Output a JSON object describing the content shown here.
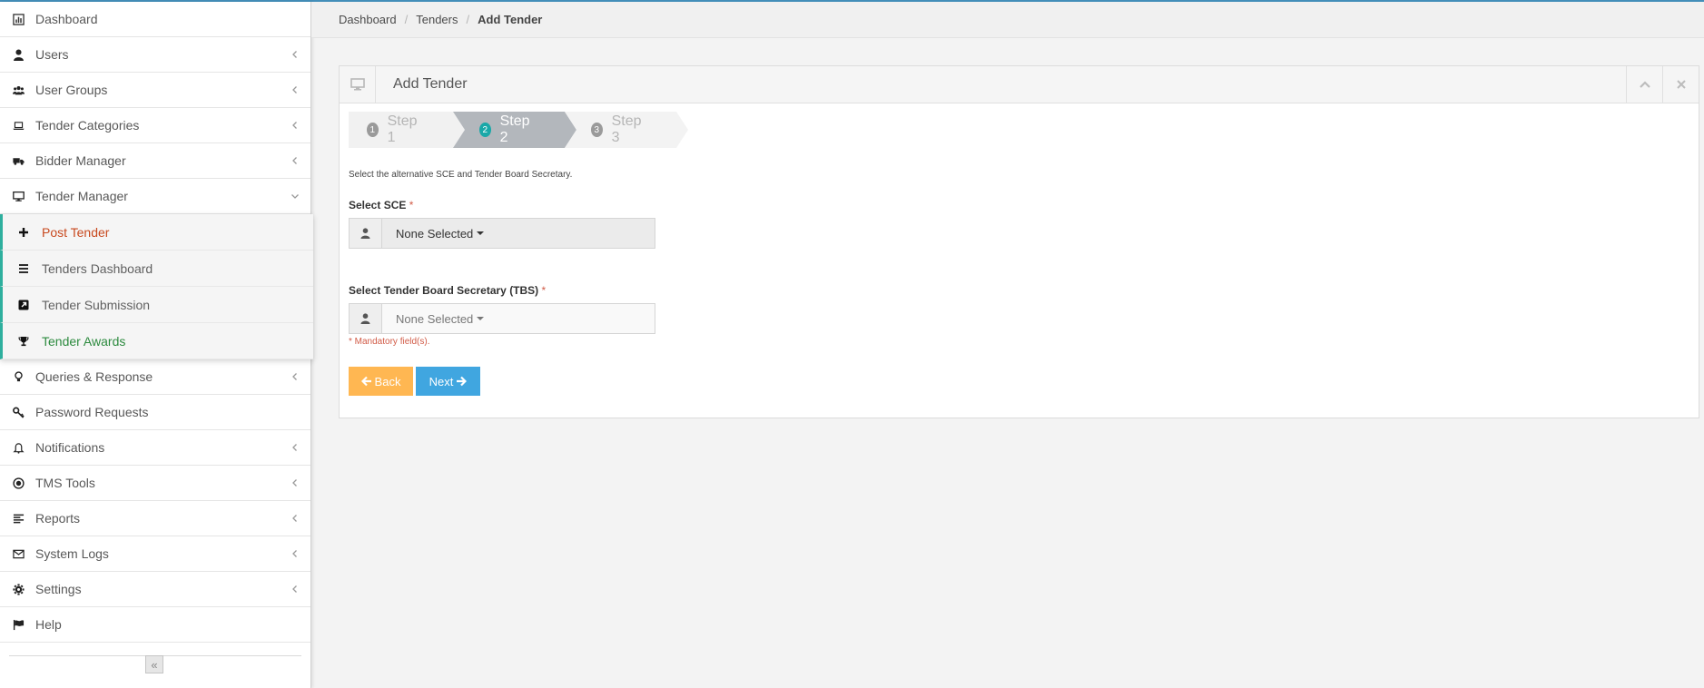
{
  "colors": {
    "accent": "#438eb9",
    "active_menu_text": "#c8491e",
    "green_menu_text": "#2c8a3e",
    "submenu_border": "#2eaf9e",
    "step_active_bg": "#b3b7bc",
    "back_button": "#ffb752",
    "next_button": "#40a6e0",
    "required": "#d15b47"
  },
  "sidebar": {
    "items_top": [
      {
        "label": "Dashboard",
        "icon": "bar-chart-icon",
        "chevron": false
      },
      {
        "label": "Users",
        "icon": "user-icon",
        "chevron": "left"
      },
      {
        "label": "User Groups",
        "icon": "users-icon",
        "chevron": "left"
      },
      {
        "label": "Tender Categories",
        "icon": "laptop-icon",
        "chevron": "left"
      },
      {
        "label": "Bidder Manager",
        "icon": "truck-icon",
        "chevron": "left"
      },
      {
        "label": "Tender Manager",
        "icon": "monitor-icon",
        "chevron": "down"
      }
    ],
    "submenu": [
      {
        "label": "Post Tender",
        "icon": "plus-icon"
      },
      {
        "label": "Tenders Dashboard",
        "icon": "list-icon"
      },
      {
        "label": "Tender Submission",
        "icon": "external-square-icon"
      },
      {
        "label": "Tender Awards",
        "icon": "trophy-icon"
      }
    ],
    "items_bottom": [
      {
        "label": "Queries & Response",
        "icon": "lightbulb-icon",
        "chevron": "left"
      },
      {
        "label": "Password Requests",
        "icon": "key-icon",
        "chevron": false
      },
      {
        "label": "Notifications",
        "icon": "bell-icon",
        "chevron": "left"
      },
      {
        "label": "TMS Tools",
        "icon": "target-icon",
        "chevron": "left"
      },
      {
        "label": "Reports",
        "icon": "align-left-icon",
        "chevron": "left"
      },
      {
        "label": "System Logs",
        "icon": "envelope-icon",
        "chevron": "left"
      },
      {
        "label": "Settings",
        "icon": "cog-icon",
        "chevron": "left"
      },
      {
        "label": "Help",
        "icon": "flag-icon",
        "chevron": false
      }
    ],
    "collapse_label": "«"
  },
  "breadcrumb": {
    "items": [
      "Dashboard",
      "Tenders"
    ],
    "current": "Add Tender"
  },
  "widget": {
    "title": "Add Tender",
    "steps": [
      {
        "num": "1",
        "label": "Step 1"
      },
      {
        "num": "2",
        "label": "Step 2"
      },
      {
        "num": "3",
        "label": "Step 3"
      }
    ],
    "description": "Select the alternative SCE and Tender Board Secretary.",
    "sce_label": "Select SCE",
    "sce_value": "None Selected",
    "tbs_label": "Select Tender Board Secretary (TBS)",
    "tbs_value": "None Selected",
    "required_mark": "*",
    "mandatory_note": "* Mandatory field(s).",
    "back_label": "Back",
    "next_label": "Next"
  }
}
